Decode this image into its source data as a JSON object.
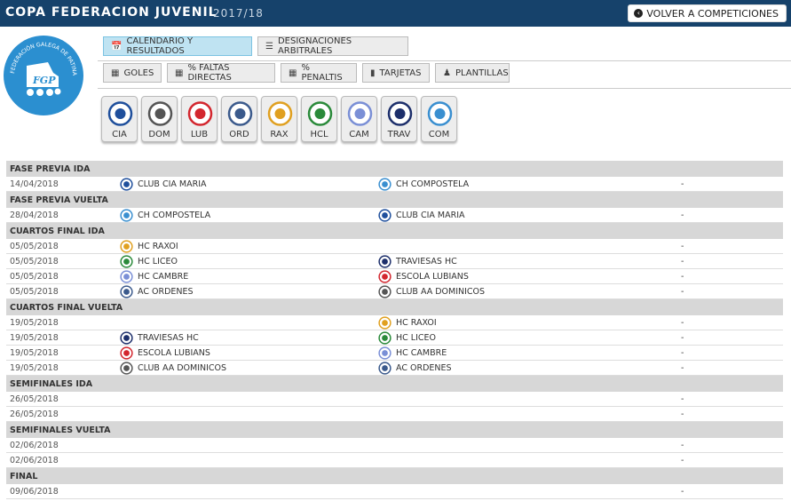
{
  "header": {
    "title": "COPA FEDERACION JUVENIL",
    "season": "2017/18",
    "back_label": "VOLVER A COMPETICIONES"
  },
  "logo": {
    "text": "FEDERACIÓN GALEGA DE PATINAXE",
    "initials": "FGP",
    "color": "#2b8fd0"
  },
  "tabs_main": [
    {
      "label": "CALENDARIO Y RESULTADOS",
      "icon": "calendar-icon",
      "active": true
    },
    {
      "label": "DESIGNACIONES ARBITRALES",
      "icon": "list-icon",
      "active": false
    }
  ],
  "tabs_stats": [
    {
      "label": "GOLES",
      "icon": "chart-icon"
    },
    {
      "label": "% FALTAS DIRECTAS",
      "icon": "chart-icon"
    },
    {
      "label": "% PENALTIS",
      "icon": "chart-icon"
    },
    {
      "label": "TARJETAS",
      "icon": "card-icon"
    },
    {
      "label": "PLANTILLAS",
      "icon": "person-icon"
    }
  ],
  "teams": [
    {
      "abbr": "CIA",
      "color": "#1f4f9c"
    },
    {
      "abbr": "DOM",
      "color": "#555555"
    },
    {
      "abbr": "LUB",
      "color": "#d3262e"
    },
    {
      "abbr": "ORD",
      "color": "#3b5a8c"
    },
    {
      "abbr": "RAX",
      "color": "#e0a020"
    },
    {
      "abbr": "HCL",
      "color": "#2a8a3a"
    },
    {
      "abbr": "CAM",
      "color": "#7a8fd6"
    },
    {
      "abbr": "TRAV",
      "color": "#1d2f6b"
    },
    {
      "abbr": "COM",
      "color": "#3a8fd0"
    }
  ],
  "schedule": [
    {
      "phase": "FASE PREVIA IDA",
      "matches": [
        {
          "date": "14/04/2018",
          "home": "CLUB CIA MARIA",
          "home_logo": "CIA",
          "away": "CH COMPOSTELA",
          "away_logo": "COM",
          "score": "-"
        }
      ]
    },
    {
      "phase": "FASE PREVIA VUELTA",
      "matches": [
        {
          "date": "28/04/2018",
          "home": "CH COMPOSTELA",
          "home_logo": "COM",
          "away": "CLUB CIA MARIA",
          "away_logo": "CIA",
          "score": "-"
        }
      ]
    },
    {
      "phase": "CUARTOS FINAL IDA",
      "matches": [
        {
          "date": "05/05/2018",
          "home": "HC RAXOI",
          "home_logo": "RAX",
          "away": "",
          "away_logo": "",
          "score": "-"
        },
        {
          "date": "05/05/2018",
          "home": "HC LICEO",
          "home_logo": "HCL",
          "away": "TRAVIESAS HC",
          "away_logo": "TRAV",
          "score": "-"
        },
        {
          "date": "05/05/2018",
          "home": "HC CAMBRE",
          "home_logo": "CAM",
          "away": "ESCOLA LUBIANS",
          "away_logo": "LUB",
          "score": "-"
        },
        {
          "date": "05/05/2018",
          "home": "AC ORDENES",
          "home_logo": "ORD",
          "away": "CLUB AA DOMINICOS",
          "away_logo": "DOM",
          "score": "-"
        }
      ]
    },
    {
      "phase": "CUARTOS FINAL VUELTA",
      "matches": [
        {
          "date": "19/05/2018",
          "home": "",
          "home_logo": "",
          "away": "HC RAXOI",
          "away_logo": "RAX",
          "score": "-"
        },
        {
          "date": "19/05/2018",
          "home": "TRAVIESAS HC",
          "home_logo": "TRAV",
          "away": "HC LICEO",
          "away_logo": "HCL",
          "score": "-"
        },
        {
          "date": "19/05/2018",
          "home": "ESCOLA LUBIANS",
          "home_logo": "LUB",
          "away": "HC CAMBRE",
          "away_logo": "CAM",
          "score": "-"
        },
        {
          "date": "19/05/2018",
          "home": "CLUB AA DOMINICOS",
          "home_logo": "DOM",
          "away": "AC ORDENES",
          "away_logo": "ORD",
          "score": "-"
        }
      ]
    },
    {
      "phase": "SEMIFINALES IDA",
      "matches": [
        {
          "date": "26/05/2018",
          "home": "",
          "home_logo": "",
          "away": "",
          "away_logo": "",
          "score": "-"
        },
        {
          "date": "26/05/2018",
          "home": "",
          "home_logo": "",
          "away": "",
          "away_logo": "",
          "score": "-"
        }
      ]
    },
    {
      "phase": "SEMIFINALES VUELTA",
      "matches": [
        {
          "date": "02/06/2018",
          "home": "",
          "home_logo": "",
          "away": "",
          "away_logo": "",
          "score": "-"
        },
        {
          "date": "02/06/2018",
          "home": "",
          "home_logo": "",
          "away": "",
          "away_logo": "",
          "score": "-"
        }
      ]
    },
    {
      "phase": "FINAL",
      "matches": [
        {
          "date": "09/06/2018",
          "home": "",
          "home_logo": "",
          "away": "",
          "away_logo": "",
          "score": "-"
        }
      ]
    }
  ]
}
